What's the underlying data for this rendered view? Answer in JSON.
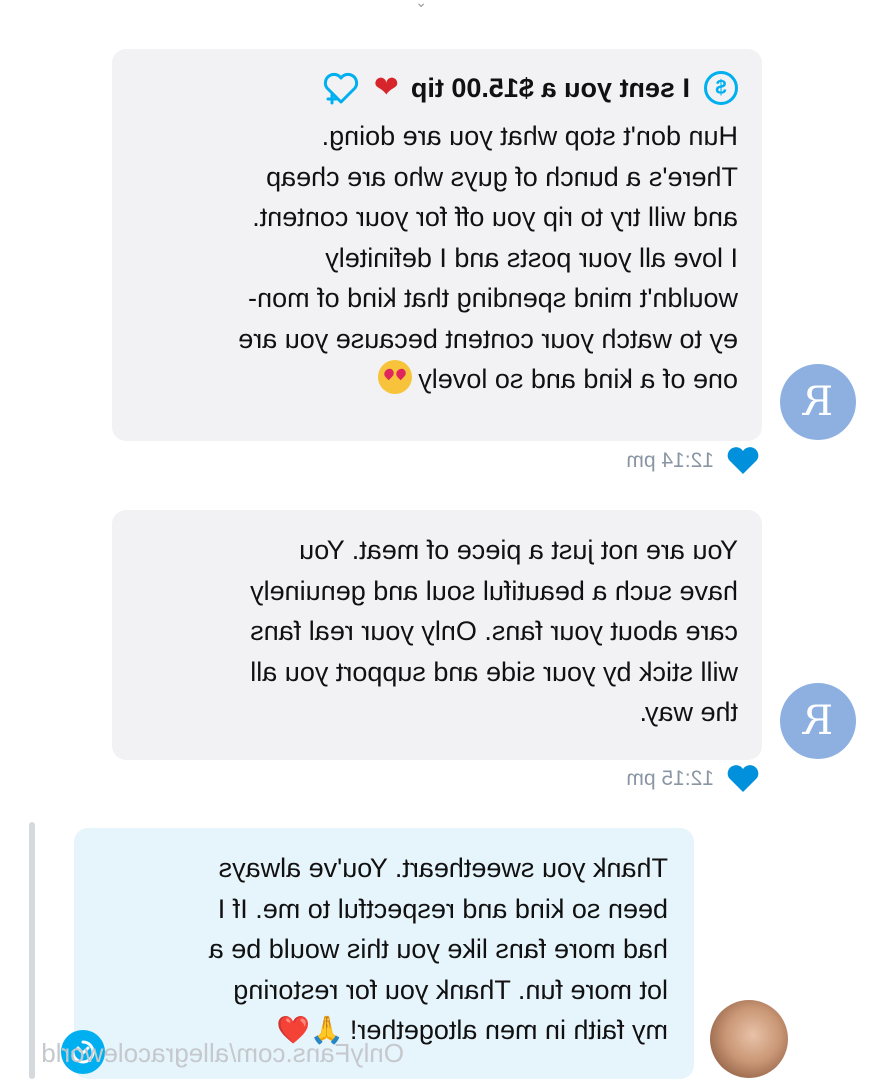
{
  "messages": [
    {
      "sender_initial": "R",
      "tip": {
        "label": "I sent you a $15.00 tip"
      },
      "lines": [
        "Hun don't stop what you are doing.",
        "There's a bunch of guys who are cheap",
        "and will try to rip you off for your content.",
        "I love all your posts and I definitely",
        "wouldn't mind spending that kind of mon-",
        "ey to watch your content because you are",
        "one of a kind and so lovely"
      ],
      "time": "12:14 pm"
    },
    {
      "sender_initial": "R",
      "lines": [
        "You are not just a piece of meat. You",
        "have such a beautiful soul and genuinely",
        "care about your fans. Only your real fans",
        "will stick by your side and support you all",
        "the way."
      ],
      "time": "12:15 pm"
    },
    {
      "lines": [
        "Thank you sweetheart. You've always",
        "been so kind and respectful to me. If I",
        "had more fans like you this would be a",
        "lot more fun. Thank you for restoring",
        "my faith in men altogether!"
      ],
      "emojis": "🙏❤️"
    }
  ],
  "watermark": "OnlyFans.com/allegracoleworld",
  "icons": [
    "dollar-icon",
    "red-heart-icon",
    "like-outline-icon",
    "heart-icon",
    "heart-eyes-emoji",
    "scroll-down-icon"
  ],
  "colors": {
    "brand": "#00aff0",
    "fan_bubble": "#f2f2f4",
    "creator_bubble": "#e6f4fc",
    "avatar": "#8db0e1"
  }
}
